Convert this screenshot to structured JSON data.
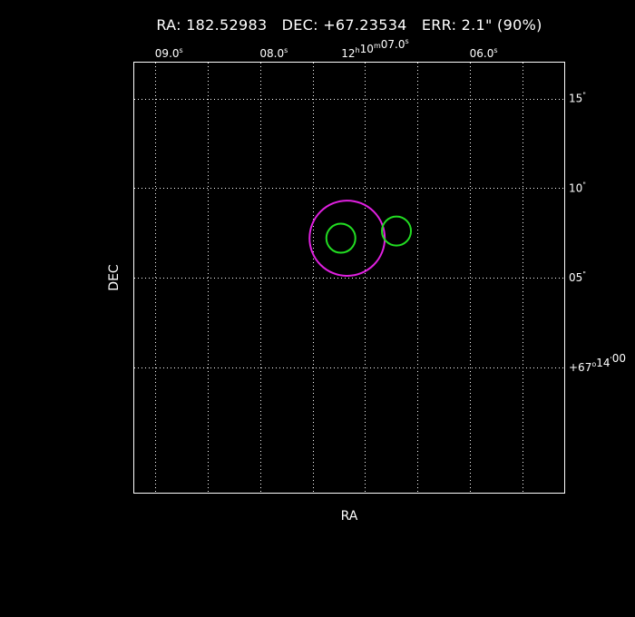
{
  "header": {
    "ra_label": "RA:",
    "ra_value": "182.52983",
    "dec_label": "DEC:",
    "dec_value": "+67.23534",
    "err_label": "ERR:",
    "err_value": "2.1\" (90%)"
  },
  "chart_data": {
    "type": "scatter",
    "xlabel": "RA",
    "ylabel": "DEC",
    "xlim": [
      9.4,
      5.3
    ],
    "ylim": [
      -7.0,
      17.0
    ],
    "grid": true,
    "x_ticks": [
      {
        "value": 9.0,
        "main": "09.0",
        "sup": "s"
      },
      {
        "value": 8.0,
        "main": "08.0",
        "sup": "s"
      },
      {
        "value": 7.0,
        "main": "12",
        "sup": "h",
        "main2": "10",
        "sup2": "m",
        "main3": "07.0",
        "sup3": "s"
      },
      {
        "value": 6.0,
        "main": "06.0",
        "sup": "s"
      }
    ],
    "x_grid": [
      9.2,
      8.7,
      8.2,
      7.7,
      7.2,
      6.7,
      6.2,
      5.7
    ],
    "y_ticks": [
      {
        "value": 15,
        "main": "15",
        "sup": "\""
      },
      {
        "value": 10,
        "main": "10",
        "sup": "\""
      },
      {
        "value": 5,
        "main": "05",
        "sup": "\""
      },
      {
        "value": 0,
        "main": "+67",
        "sup": "o",
        "main2": "14",
        "sup2": "'",
        "main3": "00",
        "sup3": ""
      }
    ],
    "y_grid": [
      15,
      10,
      5,
      0
    ],
    "error_circle": {
      "x": 7.37,
      "y": 7.2,
      "radius_arcsec": 2.1,
      "color": "#e020e0"
    },
    "sources": [
      {
        "x": 7.43,
        "y": 7.2,
        "color": "#22dd22"
      },
      {
        "x": 6.9,
        "y": 7.6,
        "color": "#22dd22"
      }
    ]
  }
}
